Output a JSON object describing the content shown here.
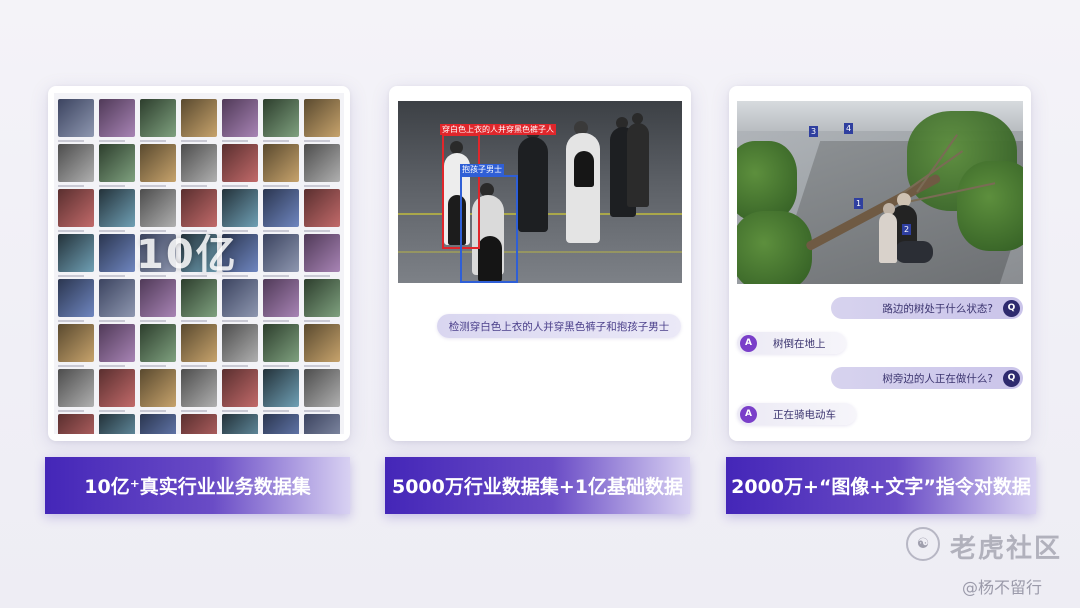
{
  "cards": [
    {
      "overlay_text": "10亿",
      "caption": "10亿⁺真实行业业务数据集"
    },
    {
      "detection_labels": {
        "person_white_top": "穿白色上衣的人并穿黑色裤子人",
        "child_holder": "抱孩子男士"
      },
      "query": "检测穿白色上衣的人并穿黑色裤子和抱孩子男士",
      "caption": "5000万行业数据集+1亿基础数据"
    },
    {
      "image_markers": [
        "3",
        "4",
        "1",
        "2"
      ],
      "qa": [
        {
          "role": "Q",
          "text": "路边的树处于什么状态?"
        },
        {
          "role": "A",
          "text": "树倒在地上"
        },
        {
          "role": "Q",
          "text": "树旁边的人正在做什么?"
        },
        {
          "role": "A",
          "text": "正在骑电动车"
        }
      ],
      "caption": "2000万+“图像+文字”指令对数据"
    }
  ],
  "watermark": {
    "title": "老虎社区",
    "author": "@杨不留行"
  },
  "colors": {
    "caption_start": "#4426b8",
    "caption_end": "#d8d1f2",
    "question_badge": "#2e2a6e",
    "answer_badge": "#7a3fc9",
    "bbox_red": "#e0262b",
    "bbox_blue": "#2f5fd6"
  }
}
